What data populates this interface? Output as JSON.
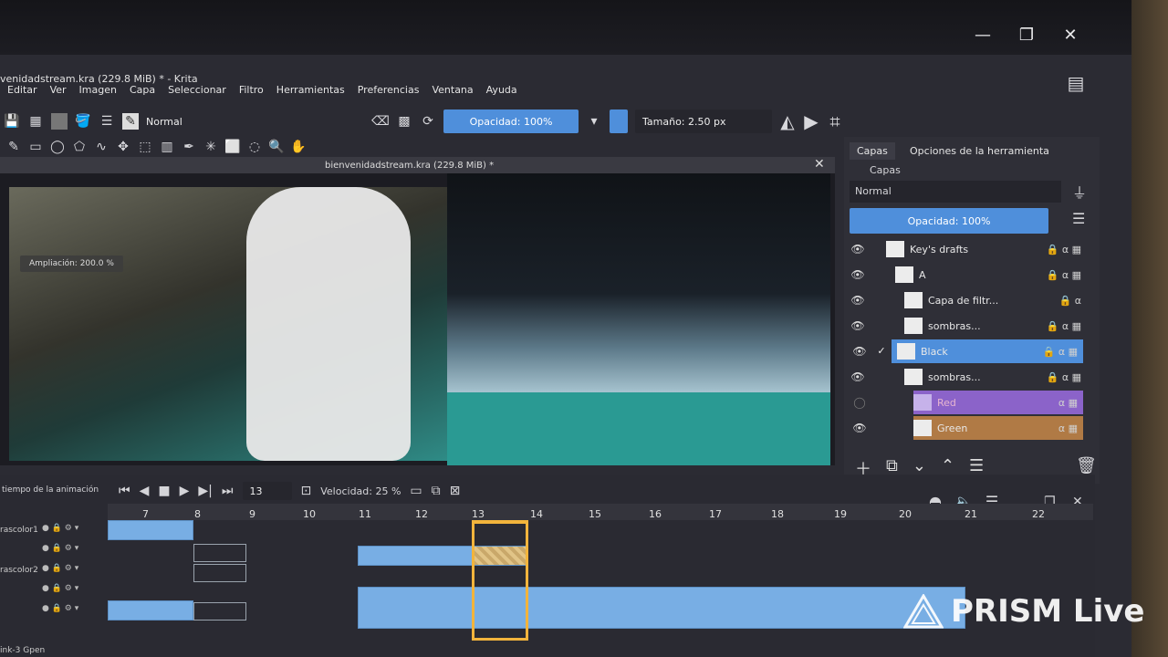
{
  "window": {
    "title": "venidadstream.kra (229.8 MiB) * - Krita",
    "minimize": "—",
    "maximize": "❐",
    "close": "✕"
  },
  "menu": [
    "Editar",
    "Ver",
    "Imagen",
    "Capa",
    "Seleccionar",
    "Filtro",
    "Herramientas",
    "Preferencias",
    "Ventana",
    "Ayuda"
  ],
  "toolbar": {
    "blend_mode": "Normal",
    "opacity": "Opacidad: 100%",
    "size": "Tamaño: 2.50 px"
  },
  "document": {
    "tab_title": "bienvenidadstream.kra (229.8 MiB) *",
    "zoom": "Ampliación: 200.0 %"
  },
  "layers_panel": {
    "tabs": [
      "Capas",
      "Opciones de la herramienta"
    ],
    "header": "Capas",
    "blend_mode": "Normal",
    "opacity": "Opacidad:  100%",
    "layers": [
      {
        "name": "Key's drafts",
        "color": "",
        "checked": ""
      },
      {
        "name": "A",
        "color": "",
        "checked": ""
      },
      {
        "name": "Capa de filtr...",
        "color": "",
        "checked": ""
      },
      {
        "name": "sombras...",
        "color": "",
        "checked": ""
      },
      {
        "name": "Black",
        "color": "#4f8fdb",
        "checked": "✓"
      },
      {
        "name": "sombras...",
        "color": "",
        "checked": ""
      },
      {
        "name": "Red",
        "color": "#8b63c9",
        "checked": ""
      },
      {
        "name": "Green",
        "color": "#b07a45",
        "checked": ""
      }
    ]
  },
  "animation": {
    "panel_title": "tiempo de la animación",
    "frame": "13",
    "speed": "Velocidad: 25 %",
    "ruler": [
      "7",
      "8",
      "9",
      "10",
      "11",
      "12",
      "13",
      "14",
      "15",
      "16",
      "17",
      "18",
      "19",
      "20",
      "21",
      "22"
    ],
    "tracks": [
      "rascolor1",
      "",
      "rascolor2",
      "",
      ""
    ],
    "bottom_label": "ink-3 Gpen"
  },
  "overlay": {
    "watermark": "PRISM Live"
  }
}
